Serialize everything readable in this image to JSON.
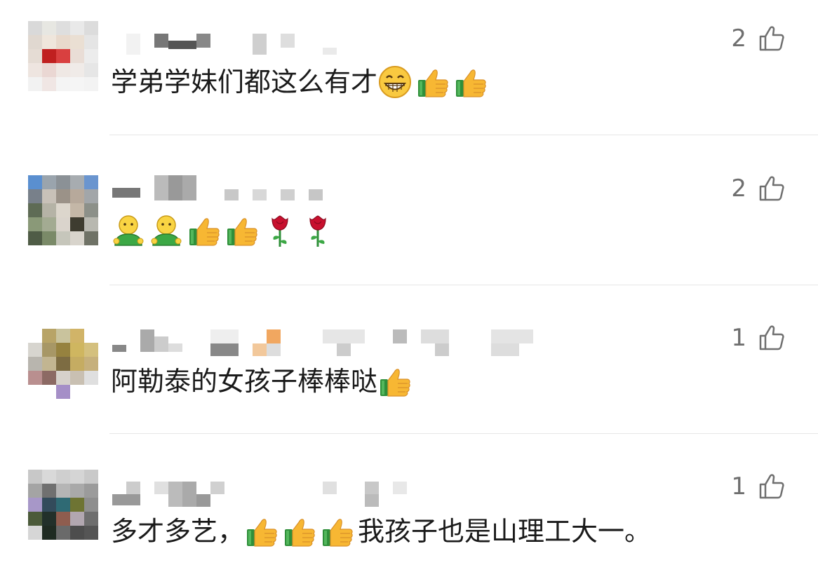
{
  "comments": [
    {
      "text_parts": [
        "学弟学妹们都这么有才"
      ],
      "emojis": [
        "grin-emoji",
        "thumbs-up-emoji",
        "thumbs-up-emoji"
      ],
      "likes": "2"
    },
    {
      "text_parts": [],
      "emojis": [
        "green-person-emoji",
        "green-person-emoji",
        "thumbs-up-emoji",
        "thumbs-up-emoji",
        "rose-emoji",
        "rose-emoji"
      ],
      "likes": "2"
    },
    {
      "text_parts": [
        "阿勒泰的女孩子棒棒哒"
      ],
      "emojis": [
        "thumbs-up-emoji"
      ],
      "likes": "1"
    },
    {
      "text_parts": [
        "多才多艺，",
        "我孩子也是山理工大一。"
      ],
      "emojis": [
        "thumbs-up-emoji",
        "thumbs-up-emoji",
        "thumbs-up-emoji"
      ],
      "likes": "1"
    }
  ],
  "icons": {
    "like": "thumbs-up-outline-icon"
  },
  "colors": {
    "text": "#1a1a1a",
    "like_count": "#6f6f6f",
    "divider": "#e6e6e6"
  }
}
